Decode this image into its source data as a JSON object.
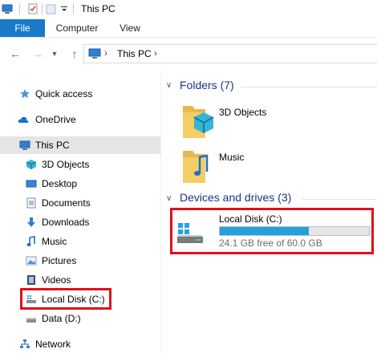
{
  "window": {
    "title": "This PC"
  },
  "ribbon": {
    "tabs": [
      "File",
      "Computer",
      "View"
    ]
  },
  "address": {
    "path": "This PC"
  },
  "nav": {
    "items": [
      {
        "label": "Quick access",
        "icon": "star-icon"
      },
      {
        "label": "OneDrive",
        "icon": "cloud-icon"
      },
      {
        "label": "This PC",
        "icon": "computer-icon"
      },
      {
        "label": "3D Objects",
        "icon": "cube-icon"
      },
      {
        "label": "Desktop",
        "icon": "desktop-icon"
      },
      {
        "label": "Documents",
        "icon": "document-icon"
      },
      {
        "label": "Downloads",
        "icon": "download-arrow-icon"
      },
      {
        "label": "Music",
        "icon": "music-note-icon"
      },
      {
        "label": "Pictures",
        "icon": "picture-icon"
      },
      {
        "label": "Videos",
        "icon": "film-icon"
      },
      {
        "label": "Local Disk (C:)",
        "icon": "drive-icon"
      },
      {
        "label": "Data (D:)",
        "icon": "drive-icon"
      },
      {
        "label": "Network",
        "icon": "network-icon"
      }
    ],
    "selected": "This PC"
  },
  "content": {
    "folders_header": "Folders (7)",
    "folders": [
      {
        "label": "3D Objects",
        "icon": "3d-objects-folder-icon"
      },
      {
        "label": "Music",
        "icon": "music-folder-icon"
      }
    ],
    "drives_header": "Devices and drives (3)",
    "drives": [
      {
        "name": "Local Disk (C:)",
        "free_text": "24.1 GB free of 60.0 GB",
        "used_fraction": 0.598
      }
    ]
  },
  "colors": {
    "accent": "#1979ca",
    "highlight": "#e0101a",
    "drive_bar": "#26a0da"
  }
}
